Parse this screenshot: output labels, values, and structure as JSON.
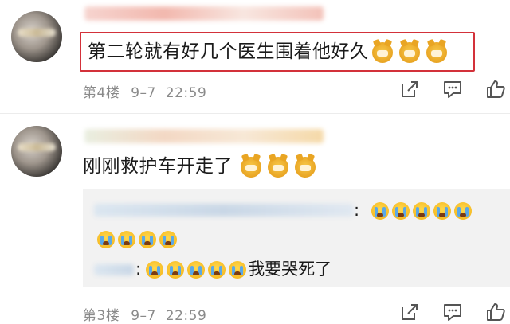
{
  "comments": [
    {
      "text": "第二轮就有好几个医生围着他好久",
      "floor": "第4楼",
      "date": "9–7",
      "time": "22:59",
      "emoji_icons": [
        "dog-emoji",
        "dog-emoji",
        "dog-emoji"
      ]
    },
    {
      "text": "刚刚救护车开走了",
      "floor": "第3楼",
      "date": "9–7",
      "time": "22:59",
      "emoji_icons": [
        "dog-emoji",
        "dog-emoji",
        "dog-emoji"
      ],
      "replies": [
        {
          "prefix": ":",
          "text": ""
        },
        {
          "prefix": ":",
          "text": "我要哭死了"
        }
      ]
    }
  ],
  "icons": {
    "share": "share-icon",
    "reply": "comment-icon",
    "like": "thumbs-up-icon"
  },
  "colors": {
    "highlight_border": "#d3313a",
    "meta_text": "#8a8a8a",
    "reply_background": "#f2f2f2"
  }
}
